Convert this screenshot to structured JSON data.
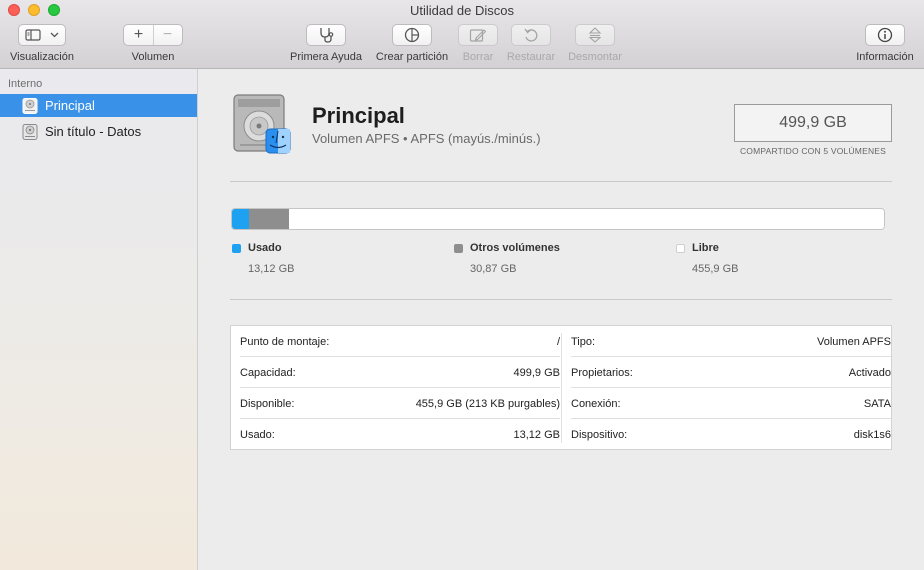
{
  "window": {
    "title": "Utilidad de Discos"
  },
  "toolbar": {
    "view_label": "Visualización",
    "volume_label": "Volumen",
    "first_aid_label": "Primera Ayuda",
    "partition_label": "Crear partición",
    "erase_label": "Borrar",
    "restore_label": "Restaurar",
    "unmount_label": "Desmontar",
    "info_label": "Información",
    "add_symbol": "+",
    "remove_symbol": "−"
  },
  "sidebar": {
    "section": "Interno",
    "items": [
      {
        "label": "Principal",
        "selected": true
      },
      {
        "label": "Sin título - Datos",
        "selected": false
      }
    ]
  },
  "volume": {
    "name": "Principal",
    "subtitle": "Volumen APFS • APFS (mayús./minús.)",
    "size": "499,9 GB",
    "shared_caption": "COMPARTIDO CON 5 VOLÚMENES"
  },
  "usage": {
    "total_gb": 499.9,
    "segments": [
      {
        "name": "Usado",
        "value": "13,12 GB",
        "gb": 13.12,
        "color": "#1ea1f1"
      },
      {
        "name": "Otros volúmenes",
        "value": "30,87 GB",
        "gb": 30.87,
        "color": "#8e8e8e"
      },
      {
        "name": "Libre",
        "value": "455,9 GB",
        "gb": 455.9,
        "color": "#ffffff"
      }
    ]
  },
  "info": {
    "left": [
      {
        "key": "Punto de montaje:",
        "value": "/"
      },
      {
        "key": "Capacidad:",
        "value": "499,9 GB"
      },
      {
        "key": "Disponible:",
        "value": "455,9 GB (213 KB purgables)"
      },
      {
        "key": "Usado:",
        "value": "13,12 GB"
      }
    ],
    "right": [
      {
        "key": "Tipo:",
        "value": "Volumen APFS"
      },
      {
        "key": "Propietarios:",
        "value": "Activado"
      },
      {
        "key": "Conexión:",
        "value": "SATA"
      },
      {
        "key": "Dispositivo:",
        "value": "disk1s6"
      }
    ]
  }
}
